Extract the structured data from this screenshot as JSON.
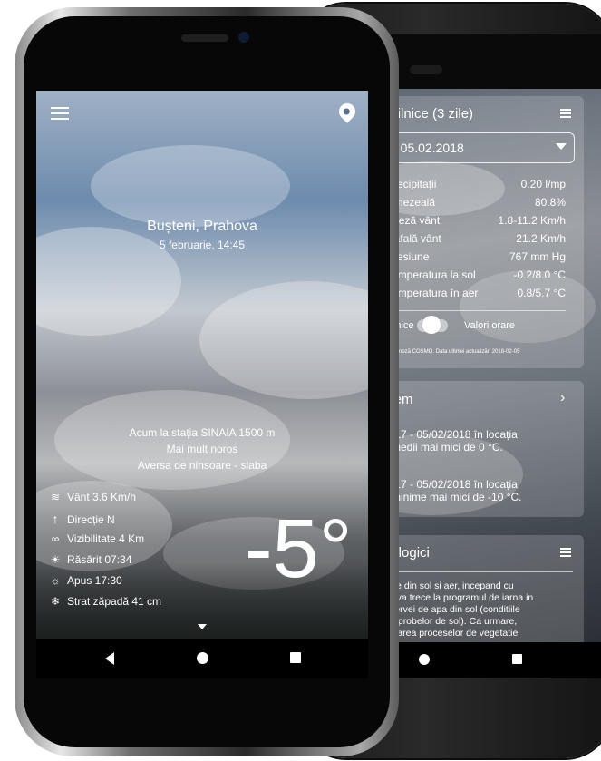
{
  "back_phone": {
    "card1": {
      "title": "dii zilnice (3 zile)",
      "icon": "list-icon",
      "date_select": "ni, 05.02.2018",
      "rows": [
        {
          "label": "Precipitații",
          "value": "0.20 l/mp"
        },
        {
          "label": "Umezeală",
          "value": "80.8%"
        },
        {
          "label": "Viteză vânt",
          "value": "1.8-11.2 Km/h"
        },
        {
          "label": "Rafală vânt",
          "value": "21.2 Km/h"
        },
        {
          "label": "Presiune",
          "value": "767 mm Hg"
        },
        {
          "label": "Temperatura la sol",
          "value": "-0.2/8.0 °C"
        },
        {
          "label": "Temperatura în aer",
          "value": "0.8/5.7 °C"
        }
      ],
      "toggle_left": "zilnice",
      "toggle_right": "Valori orare",
      "footnote": "prognoză COSMO. Data ultimei actualizări 2018-02-05"
    },
    "card2": {
      "title": "xtrem",
      "paragraph1": "1/2017 - 05/02/2018 în locația\nturi medii mai mici de 0 °C.",
      "paragraph2": "2/2017 - 05/02/2018 în locația\nturi minime mai mici de -10 °C."
    },
    "card3": {
      "title": "orologici",
      "text": "cazute din sol si aer, incepand cu\n7, se va trece la programul de iarna in\na rezervei de apa din sol (conditiile\ntarea probelor de sol). Ca urmare,\na reluarea proceselor de vegetatie"
    }
  },
  "front_phone": {
    "location": "Bușteni, Prahova",
    "datetime": "5 februarie, 14:45",
    "station": "Acum la stația SINAIA 1500 m",
    "sky": "Mai mult noros",
    "precip": "Aversa de ninsoare - slaba",
    "details": [
      {
        "icon": "wind-icon",
        "text": "Vânt 3.6 Km/h"
      },
      {
        "icon": "arrow-up-icon",
        "text": "Direcție N"
      },
      {
        "icon": "binoculars-icon",
        "text": "Vizibilitate 4 Km"
      },
      {
        "icon": "sunrise-icon",
        "text": "Răsărit 07:34"
      },
      {
        "icon": "sunset-icon",
        "text": "Apus 17:30"
      },
      {
        "icon": "snowflake-icon",
        "text": "Strat zăpadă 41 cm"
      }
    ],
    "temperature": "-5°"
  },
  "colors": {
    "text": "#ffffff",
    "card_bg": "rgba(255,255,255,0.18)",
    "navbar": "#000000"
  }
}
